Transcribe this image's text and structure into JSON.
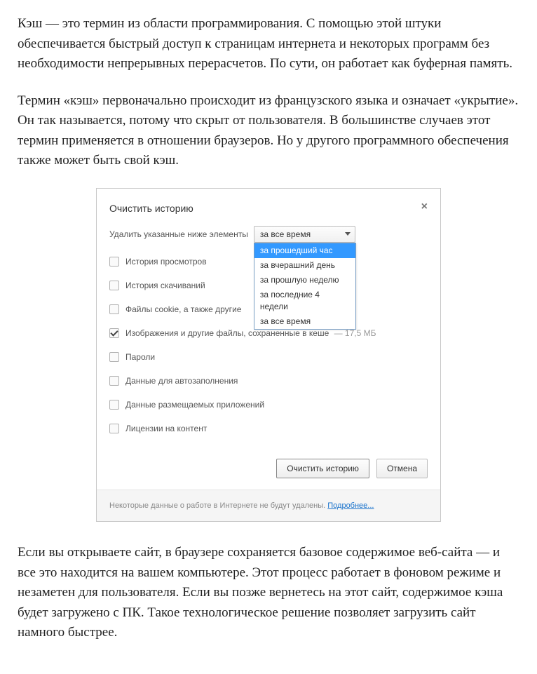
{
  "article": {
    "para1": "Кэш — это термин из области программирования. С помощью этой штуки обеспечивается быстрый доступ к страницам интернета и некоторых программ без необходимости непрерывных перерасчетов. По сути, он работает как буферная память.",
    "para2": "Термин «кэш» первоначально происходит из французского языка и означает «укрытие». Он так называется, потому что скрыт от пользователя. В большинстве случаев этот термин применяется в отношении браузеров. Но у другого программного обеспечения также может быть свой кэш.",
    "para3": "Если вы открываете сайт, в браузере сохраняется базовое содержимое веб-сайта — и все это находится на вашем компьютере. Этот процесс работает в фоновом режиме и незаметен для пользователя. Если вы позже вернетесь на этот сайт, содержимое кэша будет загружено с ПК. Такое технологическое решение позволяет загрузить сайт намного быстрее."
  },
  "dialog": {
    "title": "Очистить историю",
    "close_glyph": "×",
    "selector_label": "Удалить указанные ниже элементы",
    "selected": "за все время",
    "options": {
      "o0": "за прошедший час",
      "o1": "за вчерашний день",
      "o2": "за прошлую неделю",
      "o3": "за последние 4 недели",
      "o4": "за все время"
    },
    "items": {
      "i0": "История просмотров",
      "i1": "История скачиваний",
      "i2": "Файлы cookie, а также другие",
      "i3": "Изображения и другие файлы, сохраненные в кеше",
      "i3_extra": "—   17,5 МБ",
      "i4": "Пароли",
      "i5": "Данные для автозаполнения",
      "i6": "Данные размещаемых приложений",
      "i7": "Лицензии на контент"
    },
    "buttons": {
      "clear": "Очистить историю",
      "cancel": "Отмена"
    },
    "footer_text": "Некоторые данные о работе в Интернете не будут удалены. ",
    "footer_link": "Подробнее..."
  }
}
